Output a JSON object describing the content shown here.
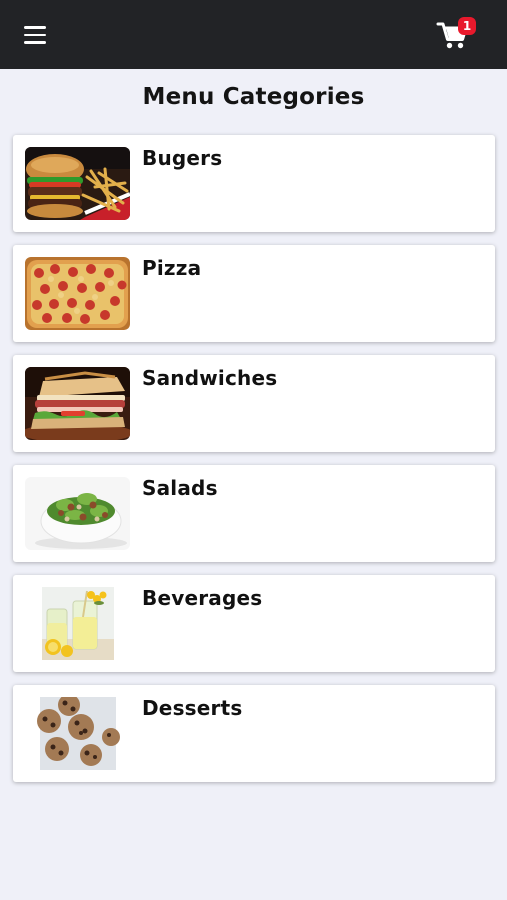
{
  "header": {
    "menu_icon": "hamburger-menu-icon",
    "cart_icon": "shopping-cart-icon",
    "cart_count": "1",
    "colors": {
      "bar": "#222326",
      "badge": "#e8192c"
    }
  },
  "page": {
    "title": "Menu Categories",
    "background": "#eff0f8"
  },
  "categories": [
    {
      "label": "Bugers",
      "image": "burger-fries-photo"
    },
    {
      "label": "Pizza",
      "image": "pepperoni-pizza-photo"
    },
    {
      "label": "Sandwiches",
      "image": "stacked-sandwich-photo"
    },
    {
      "label": "Salads",
      "image": "salad-bowl-photo"
    },
    {
      "label": "Beverages",
      "image": "lemonade-glasses-photo"
    },
    {
      "label": "Desserts",
      "image": "cookies-photo"
    }
  ]
}
